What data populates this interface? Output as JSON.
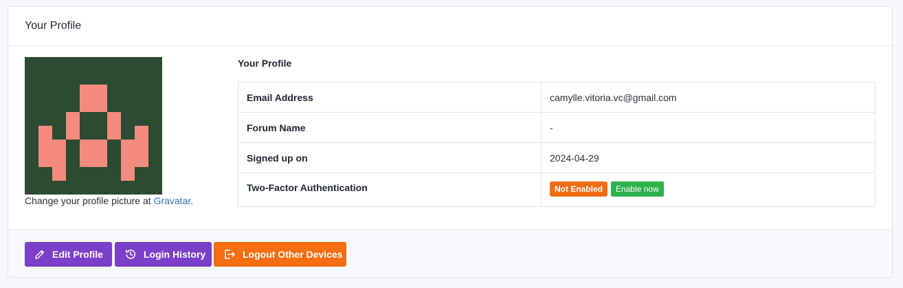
{
  "card": {
    "title": "Your Profile"
  },
  "avatar": {
    "caption_prefix": "Change your profile picture at ",
    "link_label": "Gravatar",
    "caption_suffix": ".",
    "colors": {
      "background": "#2d4a32",
      "foreground": "#f48b7e"
    }
  },
  "profile": {
    "section_title": "Your Profile",
    "rows": [
      {
        "label": "Email Address",
        "value": "camylle.vitoria.vc@gmail.com"
      },
      {
        "label": "Forum Name",
        "value": "-"
      },
      {
        "label": "Signed up on",
        "value": "2024-04-29"
      },
      {
        "label": "Two-Factor Authentication",
        "status_badge": "Not Enabled",
        "action_label": "Enable now"
      }
    ]
  },
  "footer": {
    "buttons": [
      {
        "label": "Edit Profile",
        "icon": "pencil-icon"
      },
      {
        "label": "Login History",
        "icon": "history-icon"
      },
      {
        "label": "Logout Other Devices",
        "icon": "logout-icon"
      }
    ]
  },
  "colors": {
    "primary": "#7b3fc9",
    "warning": "#f56e12",
    "success": "#2eb14a",
    "link": "#2f6fb7"
  }
}
